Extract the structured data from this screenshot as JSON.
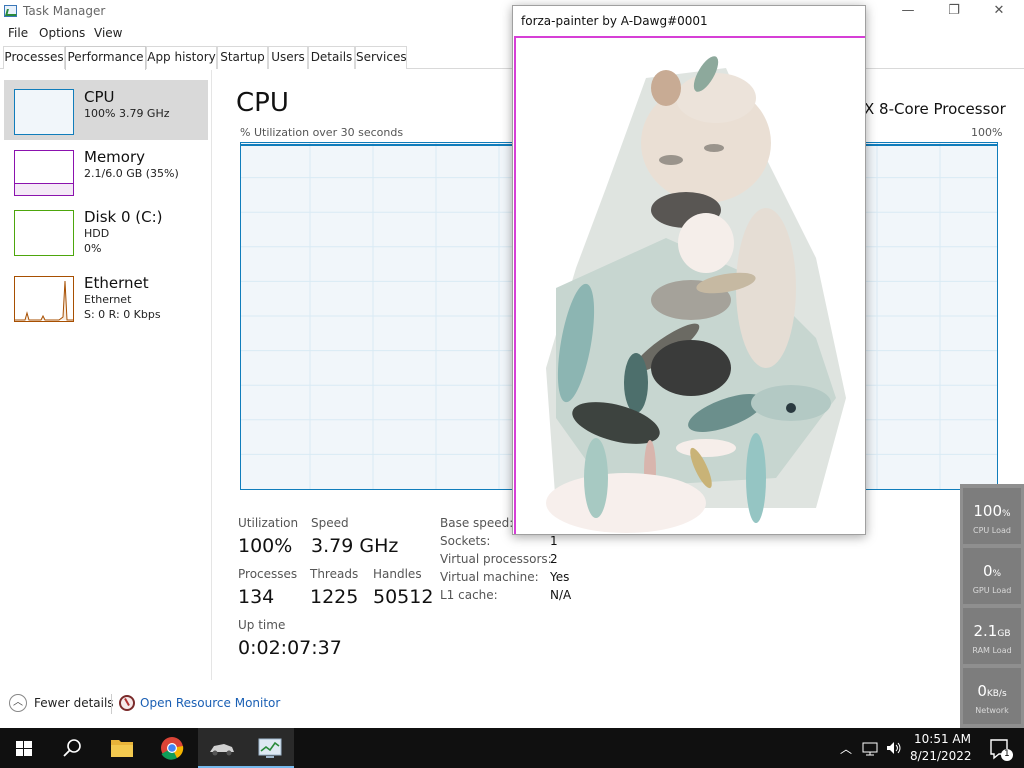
{
  "window": {
    "title": "Task Manager",
    "controls": {
      "minimize": "—",
      "maximize": "❐",
      "close": "✕"
    }
  },
  "menu": [
    "File",
    "Options",
    "View"
  ],
  "tabs": [
    "Processes",
    "Performance",
    "App history",
    "Startup",
    "Users",
    "Details",
    "Services"
  ],
  "active_tab": "Performance",
  "resources": [
    {
      "name": "CPU",
      "sub1": "100% 3.79 GHz",
      "sub2": "",
      "sub3": "",
      "color": "#117dbb"
    },
    {
      "name": "Memory",
      "sub1": "2.1/6.0 GB (35%)",
      "sub2": "",
      "sub3": "",
      "color": "#8b12ae",
      "fill": 0.35
    },
    {
      "name": "Disk 0 (C:)",
      "sub1": "HDD",
      "sub2": "0%",
      "sub3": "",
      "color": "#4da60c"
    },
    {
      "name": "Ethernet",
      "sub1": "Ethernet",
      "sub2": "S: 0 R: 0 Kbps",
      "sub3": "",
      "color": "#a74f01"
    }
  ],
  "cpu": {
    "heading": "CPU",
    "model": "X 8-Core Processor",
    "graph_label": "% Utilization over 30 seconds",
    "graph_max": "100%",
    "stats": {
      "utilization_label": "Utilization",
      "utilization": "100%",
      "speed_label": "Speed",
      "speed": "3.79 GHz",
      "processes_label": "Processes",
      "processes": "134",
      "threads_label": "Threads",
      "threads": "1225",
      "handles_label": "Handles",
      "handles": "50512",
      "uptime_label": "Up time",
      "uptime": "0:02:07:37"
    },
    "details": [
      {
        "key": "Base speed:",
        "value": ""
      },
      {
        "key": "Sockets:",
        "value": "1"
      },
      {
        "key": "Virtual processors:",
        "value": "2"
      },
      {
        "key": "Virtual machine:",
        "value": "Yes"
      },
      {
        "key": "L1 cache:",
        "value": "N/A"
      }
    ]
  },
  "footer": {
    "fewer_details": "Fewer details",
    "open_resource_monitor": "Open Resource Monitor"
  },
  "painter_window": {
    "title": "forza-painter by A-Dawg#0001"
  },
  "widget": [
    {
      "value": "100",
      "unit": "%",
      "label": "CPU Load"
    },
    {
      "value": "0",
      "unit": "%",
      "label": "GPU Load"
    },
    {
      "value": "2.1",
      "unit": "GB",
      "label": "RAM Load"
    },
    {
      "value": "0",
      "unit": "KB/s",
      "label": "Network"
    }
  ],
  "taskbar": {
    "time": "10:51 AM",
    "date": "8/21/2022",
    "notification_count": "1"
  },
  "colors": {
    "accent": "#117dbb",
    "link": "#1a5fb4",
    "taskbar": "#101010"
  }
}
